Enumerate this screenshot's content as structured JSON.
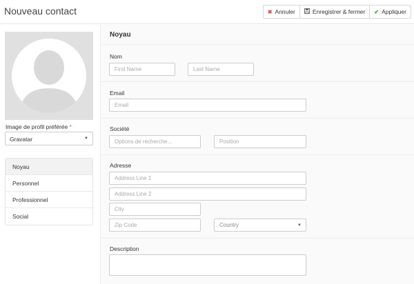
{
  "header": {
    "title": "Nouveau contact",
    "buttons": {
      "cancel": "Annuler",
      "save_close": "Enregistrer & fermer",
      "apply": "Appliquer"
    }
  },
  "left": {
    "profile_label": "Image de profil préférée",
    "required_mark": "*",
    "profile_select_value": "Gravatar",
    "nav": [
      "Noyau",
      "Personnel",
      "Professionnel",
      "Social"
    ],
    "active_nav": "Noyau"
  },
  "form": {
    "section_title": "Noyau",
    "nom_label": "Nom",
    "first_name_placeholder": "First Name",
    "last_name_placeholder": "Last Name",
    "email_label": "Email",
    "email_placeholder": "Email",
    "societe_label": "Société",
    "societe_placeholder": "Options de recherche...",
    "position_placeholder": "Position",
    "adresse_label": "Adresse",
    "address1_placeholder": "Address Line 1",
    "address2_placeholder": "Address Line 2",
    "city_placeholder": "City",
    "zip_placeholder": "Zip Code",
    "country_placeholder": "Country",
    "description_label": "Description"
  },
  "icons": {
    "cancel": "close-icon",
    "save_close": "save-icon",
    "apply": "check-icon",
    "avatar": "user-silhouette-icon"
  },
  "colors": {
    "danger": "#d9534f",
    "success": "#3c9a3c"
  }
}
